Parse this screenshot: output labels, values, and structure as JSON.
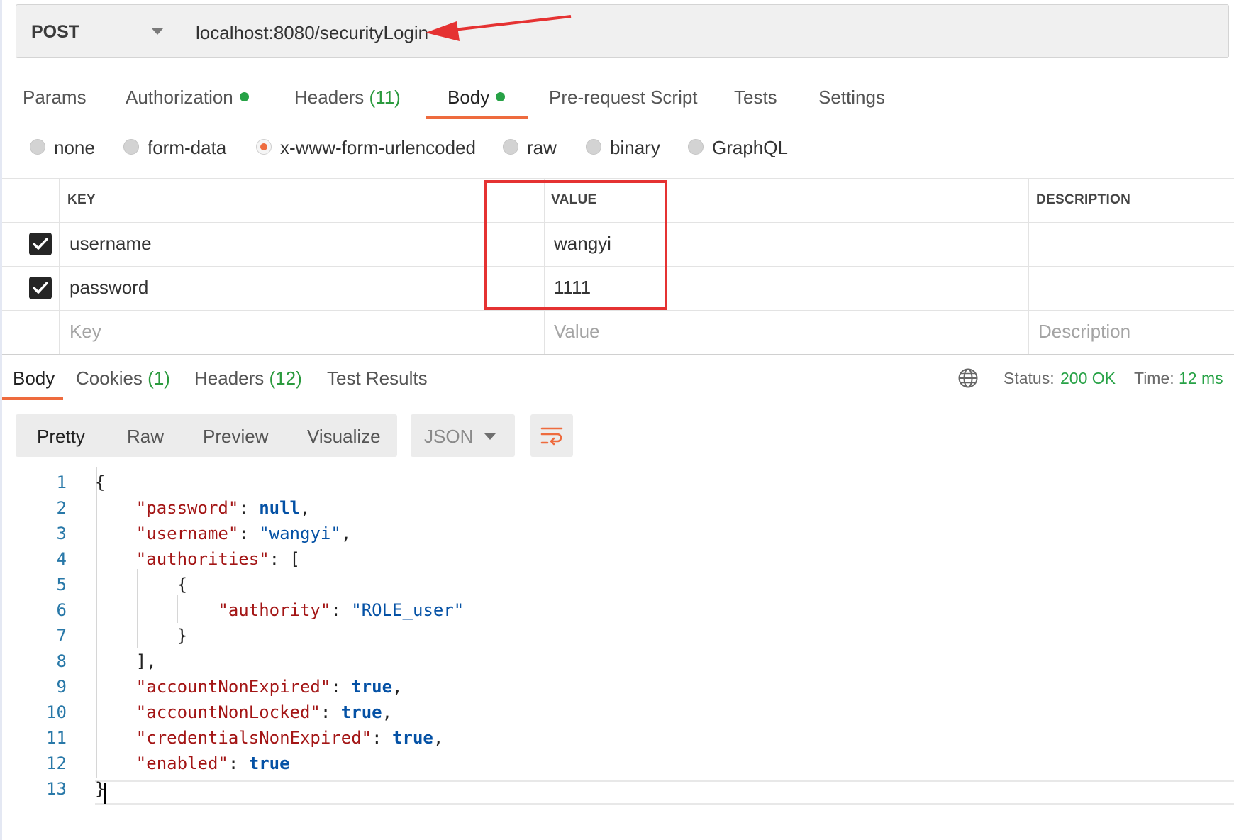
{
  "request": {
    "method": "POST",
    "url": "localhost:8080/securityLogin"
  },
  "tabs": {
    "params": "Params",
    "authorization": "Authorization",
    "headers": "Headers",
    "headers_count": "(11)",
    "body": "Body",
    "prerequest": "Pre-request Script",
    "tests": "Tests",
    "settings": "Settings"
  },
  "body_modes": {
    "none": "none",
    "form_data": "form-data",
    "urlencoded": "x-www-form-urlencoded",
    "raw": "raw",
    "binary": "binary",
    "graphql": "GraphQL",
    "selected": "x-www-form-urlencoded"
  },
  "params_table": {
    "headers": {
      "key": "KEY",
      "value": "VALUE",
      "description": "DESCRIPTION"
    },
    "rows": [
      {
        "checked": true,
        "key": "username",
        "value": "wangyi",
        "description": ""
      },
      {
        "checked": true,
        "key": "password",
        "value": "1111",
        "description": ""
      }
    ],
    "placeholders": {
      "key": "Key",
      "value": "Value",
      "description": "Description"
    }
  },
  "response": {
    "tabs": {
      "body": "Body",
      "cookies": "Cookies",
      "cookies_count": "(1)",
      "headers": "Headers",
      "headers_count": "(12)",
      "test_results": "Test Results"
    },
    "status_label": "Status:",
    "status_value": "200 OK",
    "time_label": "Time:",
    "time_value": "12 ms",
    "views": {
      "pretty": "Pretty",
      "raw": "Raw",
      "preview": "Preview",
      "visualize": "Visualize"
    },
    "format": "JSON",
    "code": {
      "line_numbers": [
        "1",
        "2",
        "3",
        "4",
        "5",
        "6",
        "7",
        "8",
        "9",
        "10",
        "11",
        "12",
        "13"
      ],
      "open_brace": "{",
      "password_key": "\"password\"",
      "password_value": "null",
      "username_key": "\"username\"",
      "username_value": "\"wangyi\"",
      "authorities_key": "\"authorities\"",
      "inner_open": "{",
      "authority_key": "\"authority\"",
      "authority_value": "\"ROLE_user\"",
      "inner_close": "}",
      "array_close": "],",
      "accountNonExpired_key": "\"accountNonExpired\"",
      "accountNonExpired_value": "true",
      "accountNonLocked_key": "\"accountNonLocked\"",
      "accountNonLocked_value": "true",
      "credentialsNonExpired_key": "\"credentialsNonExpired\"",
      "credentialsNonExpired_value": "true",
      "enabled_key": "\"enabled\"",
      "enabled_value": "true",
      "close_brace": "}"
    }
  },
  "colors": {
    "accent": "#ee6b3e",
    "status_green": "#27a246",
    "annotation_red": "#e53232"
  },
  "icons": [
    "caret-down-icon",
    "dot-icon",
    "radio-icon",
    "checkbox-checked-icon",
    "globe-icon",
    "wrap-lines-icon",
    "red-arrow-annotation"
  ]
}
